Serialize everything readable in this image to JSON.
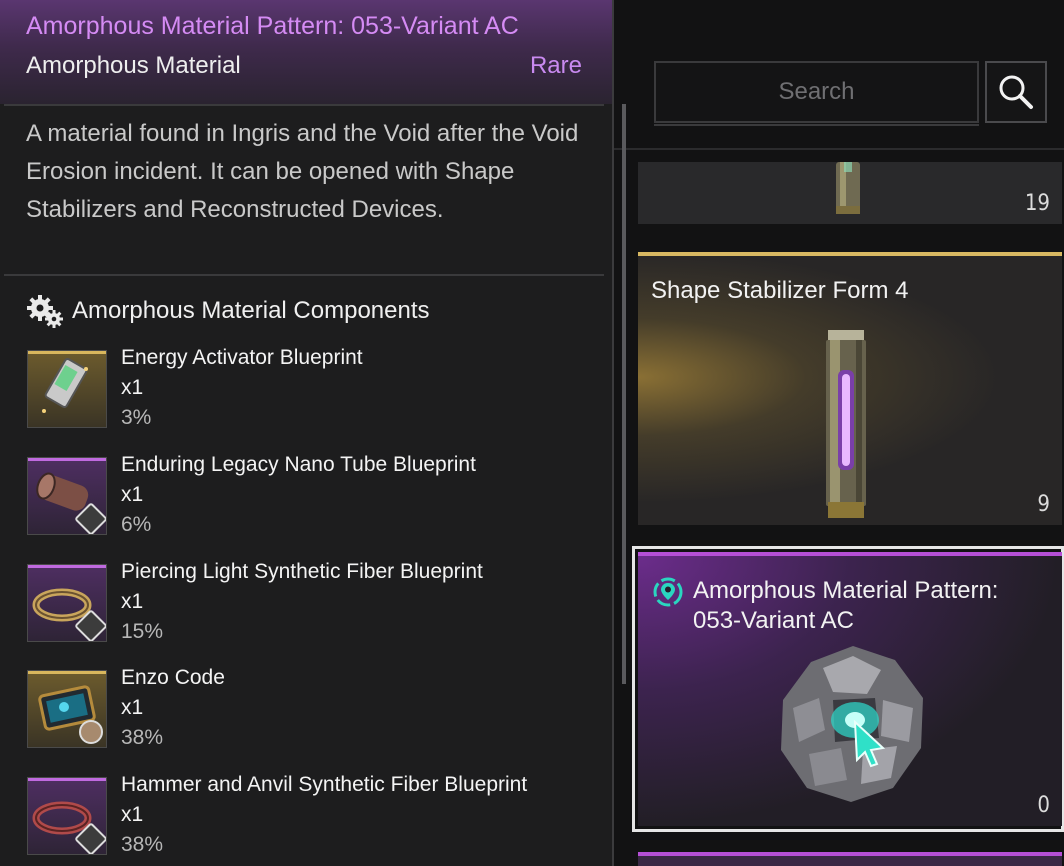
{
  "tooltip": {
    "title": "Amorphous Material Pattern: 053-Variant AC",
    "category": "Amorphous Material",
    "rarity": "Rare",
    "description": "A material found in Ingris and the Void after the Void Erosion incident. It can be opened with Shape Stabilizers and Reconstructed Devices.",
    "components_heading": "Amorphous Material Components",
    "components": [
      {
        "name": "Energy Activator Blueprint",
        "qty": "x1",
        "chance": "3%",
        "rarity_color": "#d9b75d",
        "icon": "energy-activator-icon"
      },
      {
        "name": "Enduring Legacy Nano Tube Blueprint",
        "qty": "x1",
        "chance": "6%",
        "rarity_color": "#c06ae0",
        "icon": "nano-tube-icon"
      },
      {
        "name": "Piercing Light Synthetic Fiber Blueprint",
        "qty": "x1",
        "chance": "15%",
        "rarity_color": "#c06ae0",
        "icon": "synthetic-fiber-icon"
      },
      {
        "name": "Enzo Code",
        "qty": "x1",
        "chance": "38%",
        "rarity_color": "#d9b75d",
        "icon": "code-tablet-icon"
      },
      {
        "name": "Hammer and Anvil Synthetic Fiber Blueprint",
        "qty": "x1",
        "chance": "38%",
        "rarity_color": "#c06ae0",
        "icon": "synthetic-fiber-icon"
      }
    ]
  },
  "search": {
    "placeholder": "Search"
  },
  "inventory": [
    {
      "name": "",
      "count": "19",
      "rarity_color": "#8a8a8a"
    },
    {
      "name": "Shape Stabilizer Form 4",
      "count": "9",
      "rarity_color": "#d8b862"
    },
    {
      "name": "Amorphous Material Pattern: 053-Variant AC",
      "count": "0",
      "rarity_color": "#b54fd6",
      "selected": true
    }
  ],
  "colors": {
    "rare_purple": "#c98af0",
    "title_purple": "#d58bf4",
    "gold": "#d8b862",
    "tracked_teal": "#2ad6c0"
  }
}
